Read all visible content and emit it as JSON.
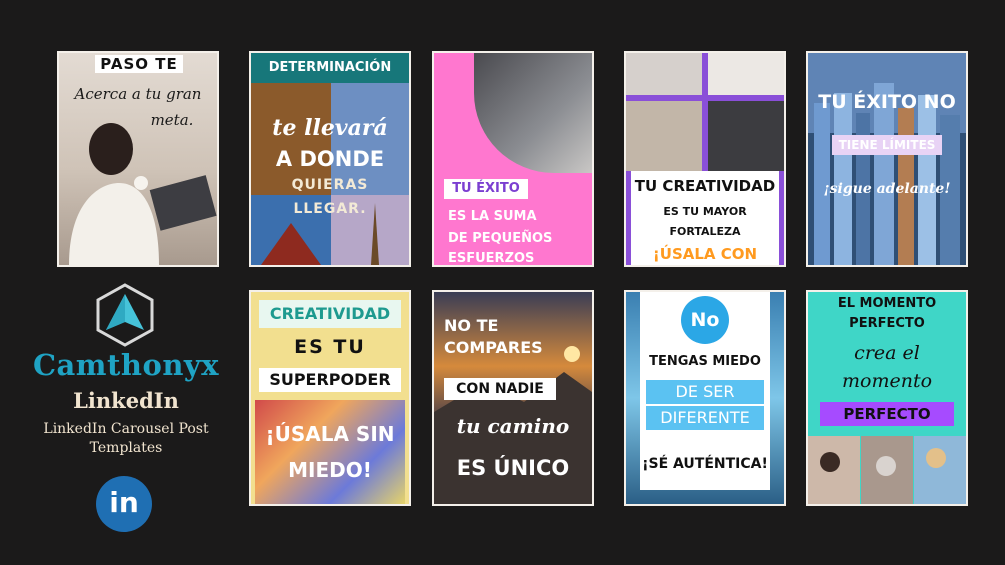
{
  "colors": {
    "background": "#1b1a1a",
    "brand_teal": "#1fa3c4",
    "brand_cream": "#f1e4cf",
    "linkedin_blue": "#1f6fb3"
  },
  "brand": {
    "name": "Camthonyx",
    "network": "LinkedIn",
    "description_line1": "LinkedIn Carousel Post",
    "description_line2": "Templates",
    "logo_icon": "triangle-arrow-hexagon-icon",
    "social_icon": "linkedin-icon",
    "social_label": "in"
  },
  "cards": {
    "c1": {
      "title": "PASO TE",
      "script1": "Acerca a tu gran",
      "script2": "meta."
    },
    "c2": {
      "header": "DETERMINACIÓN",
      "line1": "te llevará",
      "line2": "A DONDE",
      "line3": "QUIERAS",
      "line4": "LLEGAR."
    },
    "c3": {
      "tag": "TU ÉXITO",
      "line1": "ES LA SUMA",
      "line2": "DE PEQUEÑOS",
      "line3": "ESFUERZOS"
    },
    "c4": {
      "title": "TU CREATIVIDAD",
      "line1": "ES TU MAYOR",
      "line2": "FORTALEZA",
      "line3": "¡ÚSALA CON"
    },
    "c5": {
      "title": "TU ÉXITO NO",
      "tag": "TIENE LÍMITES",
      "script": "¡sigue adelante!"
    },
    "c6": {
      "title": "CREATIVIDAD",
      "line1": "ES TU",
      "line2": "SUPERPODER",
      "line3": "¡ÚSALA SIN",
      "line4": "MIEDO!"
    },
    "c7": {
      "line1": "NO TE",
      "line2": "COMPARES",
      "tag": "CON NADIE",
      "script": "tu camino",
      "line3": "ES ÚNICO"
    },
    "c8": {
      "circle": "No",
      "line1": "TENGAS MIEDO",
      "tag1": "DE SER",
      "tag2": "DIFERENTE",
      "line2": "¡SÉ AUTÉNTICA!"
    },
    "c9": {
      "line1": "EL MOMENTO",
      "line2": "PERFECTO",
      "script1": "crea el",
      "script2": "momento",
      "tag": "PERFECTO"
    }
  }
}
